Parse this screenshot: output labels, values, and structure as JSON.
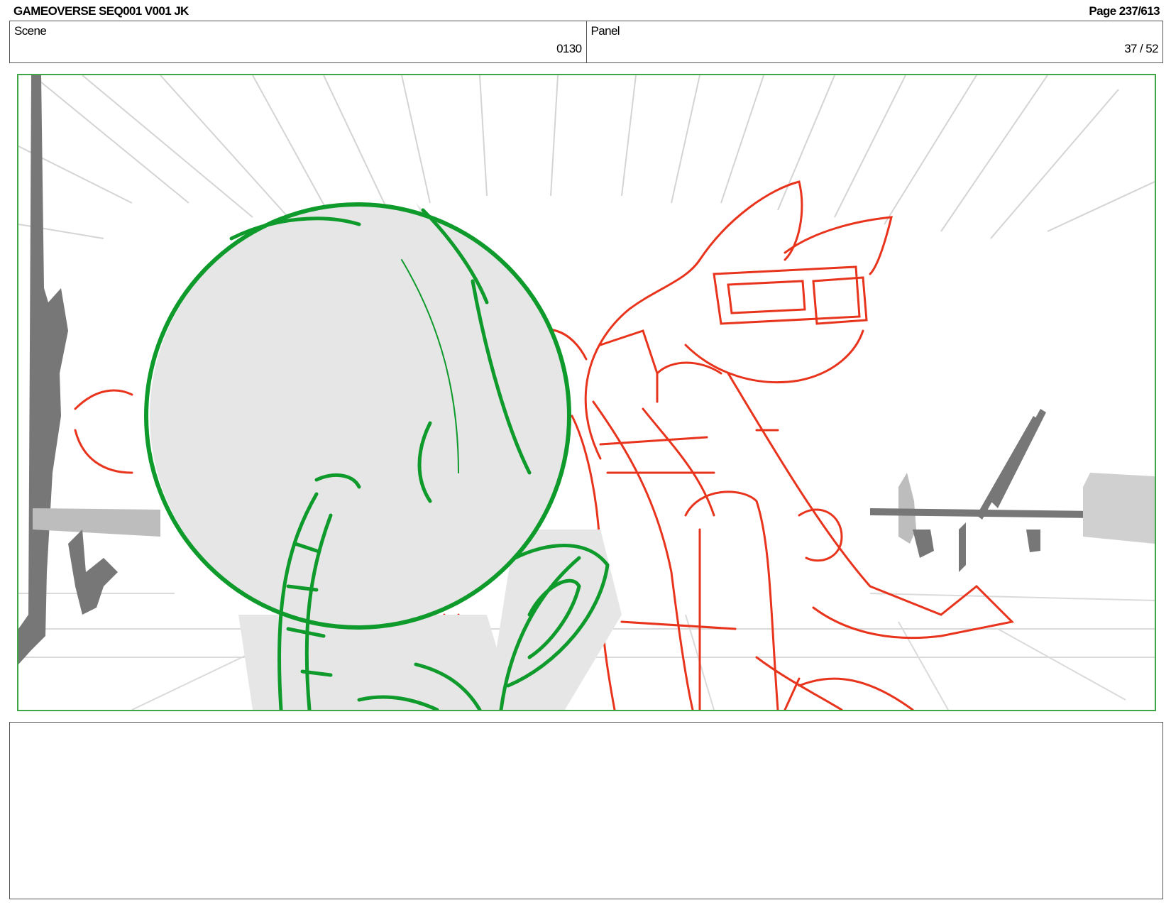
{
  "header": {
    "title": "GAMEOVERSE SEQ001 V001 JK",
    "page": "Page 237/613"
  },
  "info": {
    "scene_label": "Scene",
    "scene_value": "0130",
    "panel_label": "Panel",
    "panel_value": "37 / 52"
  },
  "panel": {
    "frame_color": "#3fa645",
    "sketch_colors": {
      "green_character": "#0f9a2c",
      "red_character": "#e8341c",
      "background_gray": "#777777",
      "fill_gray": "#e6e6e6"
    }
  },
  "notes": {
    "text": ""
  }
}
